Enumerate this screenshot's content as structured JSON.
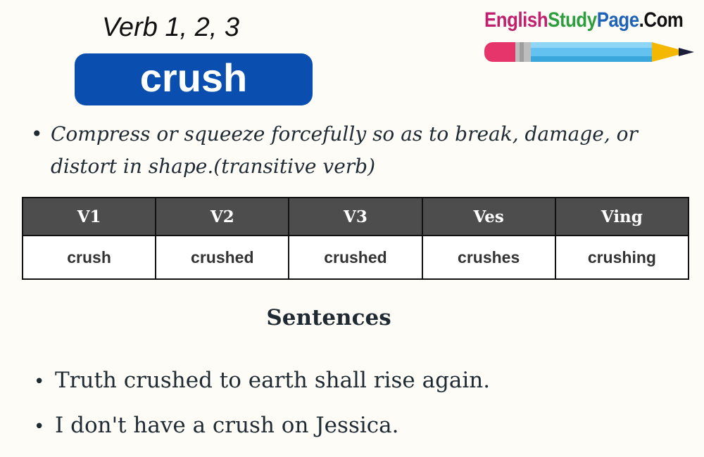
{
  "header": {
    "subtitle": "Verb 1, 2, 3",
    "word": "crush",
    "badge_color": "#0a4fb0"
  },
  "logo": {
    "part1": "English",
    "part2": "Study",
    "part3": "Page",
    "part4": ".Com",
    "icon": "pencil-icon"
  },
  "definition": {
    "bullet": "•",
    "text": "Compress or squeeze forcefully so as to break, damage, or distort in shape.(transitive verb)"
  },
  "table": {
    "headers": [
      "V1",
      "V2",
      "V3",
      "Ves",
      "Ving"
    ],
    "values": [
      "crush",
      "crushed",
      "crushed",
      "crushes",
      "crushing"
    ],
    "header_bg": "#4d4d4d"
  },
  "sentences": {
    "title": "Sentences",
    "bullet": "•",
    "items": [
      "Truth crushed to earth shall rise again.",
      "I don't have a crush on Jessica."
    ]
  }
}
